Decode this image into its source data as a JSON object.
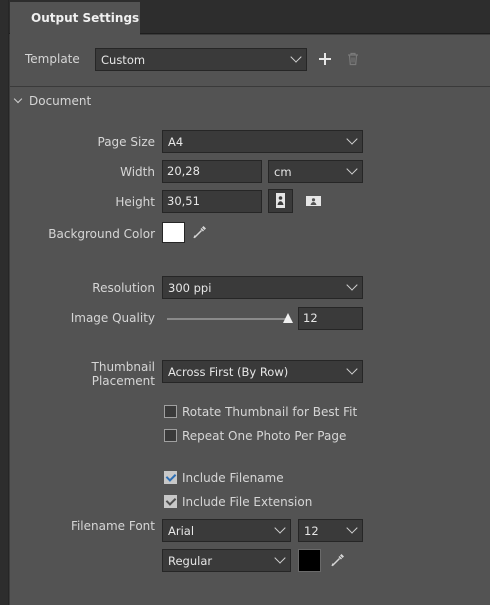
{
  "tab": {
    "title": "Output Settings"
  },
  "template": {
    "label": "Template",
    "value": "Custom",
    "add_icon": "plus-icon",
    "delete_icon": "trash-icon"
  },
  "document": {
    "section_label": "Document",
    "page_size": {
      "label": "Page Size",
      "value": "A4"
    },
    "width": {
      "label": "Width",
      "value": "20,28",
      "unit": "cm"
    },
    "height": {
      "label": "Height",
      "value": "30,51"
    },
    "background_color": {
      "label": "Background Color",
      "color": "#ffffff"
    },
    "resolution": {
      "label": "Resolution",
      "value": "300 ppi"
    },
    "image_quality": {
      "label": "Image Quality",
      "value": "12",
      "slider_fraction": 0.98
    },
    "thumbnail_placement": {
      "label_line1": "Thumbnail",
      "label_line2": "Placement",
      "value": "Across First (By Row)"
    },
    "rotate_thumbnail": {
      "label": "Rotate Thumbnail for Best Fit",
      "checked": false
    },
    "repeat_photo": {
      "label": "Repeat One Photo Per Page",
      "checked": false
    },
    "include_filename": {
      "label": "Include Filename",
      "checked": true
    },
    "include_extension": {
      "label": "Include File Extension",
      "checked": true
    },
    "filename_font": {
      "label": "Filename Font",
      "family": "Arial",
      "size": "12",
      "style": "Regular",
      "color": "#000000"
    }
  }
}
